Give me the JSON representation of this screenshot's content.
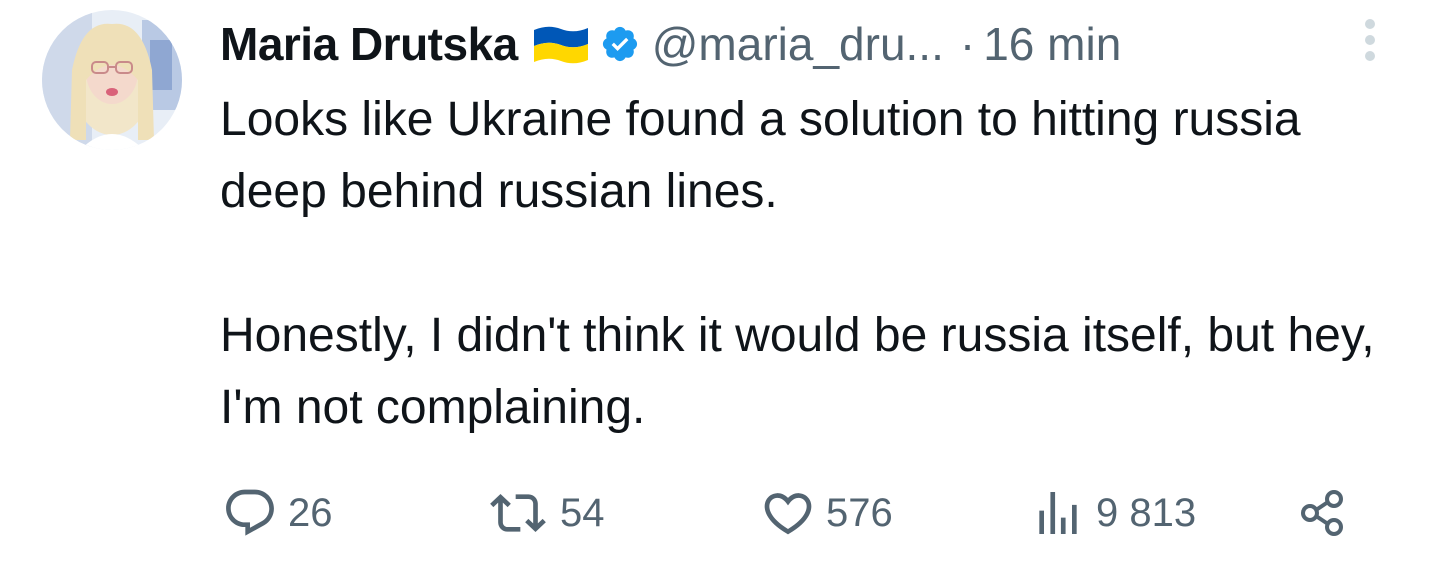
{
  "author": {
    "display_name": "Maria Drutska",
    "flag_icon": "ukraine-flag-icon",
    "verified_icon": "verified-badge-icon",
    "handle": "@maria_dru...",
    "separator": "·",
    "time": "16 min"
  },
  "tweet": {
    "paragraphs": [
      "Looks like Ukraine found a solution to hitting russia deep behind russian lines.",
      "Honestly, I didn't think it would be russia itself, but hey, I'm not complaining."
    ]
  },
  "actions": {
    "replies": "26",
    "retweets": "54",
    "likes": "576",
    "views": "9 813"
  },
  "colors": {
    "text": "#0f1419",
    "secondary": "#536471",
    "verified": "#1d9bf0",
    "flag_blue": "#0057b7",
    "flag_yellow": "#ffd700"
  }
}
